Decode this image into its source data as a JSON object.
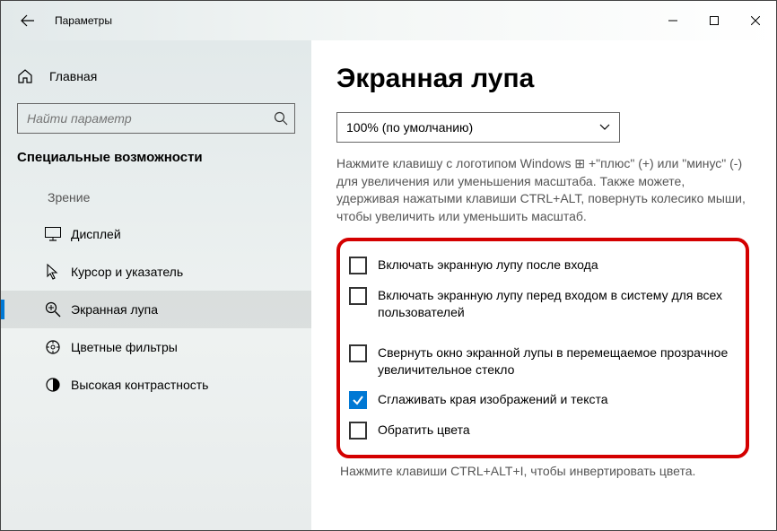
{
  "titlebar": {
    "app_title": "Параметры"
  },
  "sidebar": {
    "home_label": "Главная",
    "search_placeholder": "Найти параметр",
    "category_header": "Специальные возможности",
    "section_caption": "Зрение",
    "items": [
      {
        "label": "Дисплей",
        "icon": "display-icon",
        "selected": false
      },
      {
        "label": "Курсор и указатель",
        "icon": "cursor-icon",
        "selected": false
      },
      {
        "label": "Экранная лупа",
        "icon": "magnifier-icon",
        "selected": true
      },
      {
        "label": "Цветные фильтры",
        "icon": "color-filter-icon",
        "selected": false
      },
      {
        "label": "Высокая контрастность",
        "icon": "contrast-icon",
        "selected": false
      }
    ]
  },
  "main": {
    "page_title": "Экранная лупа",
    "dropdown_value": "100% (по умолчанию)",
    "help_text": "Нажмите клавишу с логотипом Windows ⊞ +\"плюс\" (+) или \"минус\" (-) для увеличения или уменьшения масштаба. Также можете, удерживая нажатыми клавиши CTRL+ALT, повернуть колесико мыши, чтобы увеличить или уменьшить масштаб.",
    "checkboxes": {
      "cb1": {
        "label": "Включать экранную лупу после входа",
        "checked": false
      },
      "cb2": {
        "label": "Включать экранную лупу перед входом в систему для всех пользователей",
        "checked": false
      },
      "cb3": {
        "label": "Свернуть окно экранной лупы в перемещаемое прозрачное увеличительное стекло",
        "checked": false
      },
      "cb4": {
        "label": "Сглаживать края изображений и текста",
        "checked": true
      },
      "cb5": {
        "label": "Обратить цвета",
        "checked": false
      }
    },
    "invert_hint": "Нажмите клавиши CTRL+ALT+I, чтобы инвертировать цвета."
  }
}
